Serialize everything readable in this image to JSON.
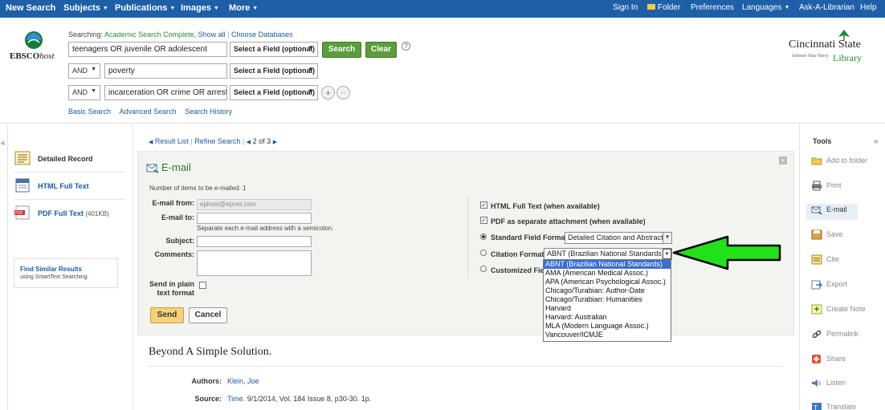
{
  "nav": {
    "left": [
      {
        "label": "New Search",
        "caret": false
      },
      {
        "label": "Subjects",
        "caret": true
      },
      {
        "label": "Publications",
        "caret": true
      },
      {
        "label": "Images",
        "caret": true
      },
      {
        "label": "More",
        "caret": true
      }
    ],
    "right": [
      "Sign In",
      "Folder",
      "Preferences",
      "Languages",
      "Ask-A-Librarian",
      "Help"
    ]
  },
  "search": {
    "logo_main": "EBSCO",
    "logo_sub": "host",
    "searching_prefix": "Searching:",
    "database": "Academic Search Complete",
    "show_all": "Show all",
    "choose_db": "Choose Databases",
    "rows": [
      {
        "op": "",
        "term": "teenagers OR juvenile OR adolescent",
        "field": "Select a Field (optional)"
      },
      {
        "op": "AND",
        "term": "poverty",
        "field": "Select a Field (optional)"
      },
      {
        "op": "AND",
        "term": "incarceration OR crime OR arrest",
        "field": "Select a Field (optional)"
      }
    ],
    "search_btn": "Search",
    "clear_btn": "Clear",
    "help": "?",
    "links": [
      "Basic Search",
      "Advanced Search",
      "Search History"
    ]
  },
  "library": {
    "name1": "Cincinnati State",
    "sub": "Johnnie Mae Berry",
    "name2": "Library"
  },
  "resultnav": {
    "result_list": "Result List",
    "refine": "Refine Search",
    "position": "2 of 3"
  },
  "leftcol": {
    "detailed": "Detailed Record",
    "html": "HTML Full Text",
    "pdf": "PDF Full Text",
    "pdf_size": "(401KB)",
    "similar_title": "Find Similar Results",
    "similar_sub": "using SmartText Searching."
  },
  "tools": {
    "title": "Tools",
    "items": [
      {
        "label": "Add to folder",
        "icon": "folder-icon"
      },
      {
        "label": "Print",
        "icon": "print-icon"
      },
      {
        "label": "E-mail",
        "icon": "email-icon"
      },
      {
        "label": "Save",
        "icon": "save-icon"
      },
      {
        "label": "Cite",
        "icon": "cite-icon"
      },
      {
        "label": "Export",
        "icon": "export-icon"
      },
      {
        "label": "Create Note",
        "icon": "note-icon"
      },
      {
        "label": "Permalink",
        "icon": "link-icon"
      },
      {
        "label": "Share",
        "icon": "share-icon"
      },
      {
        "label": "Listen",
        "icon": "speaker-icon"
      },
      {
        "label": "Translate",
        "icon": "translate-icon"
      }
    ]
  },
  "email": {
    "title": "E-mail",
    "count": "Number of items to be e-mailed: 1",
    "from_label": "E-mail from:",
    "from_value": "ephost@epnet.com",
    "to_label": "E-mail to:",
    "to_value": "",
    "hint": "Separate each e-mail address with a semicolon.",
    "subject_label": "Subject:",
    "comments_label": "Comments:",
    "plain_label1": "Send in plain",
    "plain_label2": "text format",
    "send": "Send",
    "cancel": "Cancel",
    "html_full": "HTML Full Text (when available)",
    "pdf_attach": "PDF as separate attachment (when available)",
    "standard_label": "Standard Field Format",
    "standard_value": "Detailed Citation and Abstract",
    "citation_label": "Citation Format",
    "citation_value": "ABNT (Brazilian National Standards)",
    "custom_label": "Customized Field",
    "options": [
      "ABNT (Brazilian National Standards)",
      "AMA (American Medical Assoc.)",
      "APA (American Psychological Assoc.)",
      "Chicago/Turabian: Author-Date",
      "Chicago/Turabian: Humanities",
      "Harvard",
      "Harvard: Australian",
      "MLA (Modern Language Assoc.)",
      "Vancouver/ICMJE"
    ]
  },
  "record": {
    "title": "Beyond A Simple Solution.",
    "authors_label": "Authors:",
    "authors": "Klein, Joe",
    "source_label": "Source:",
    "source_pub": "Time.",
    "source_rest": "9/1/2014, Vol. 184 Issue 8, p30-30. 1p."
  },
  "colors": {
    "nav": "#1f5fa8",
    "green_btn": "#5a9e3c",
    "arrow": "#22e01a",
    "highlight": "#3a6fd1"
  }
}
